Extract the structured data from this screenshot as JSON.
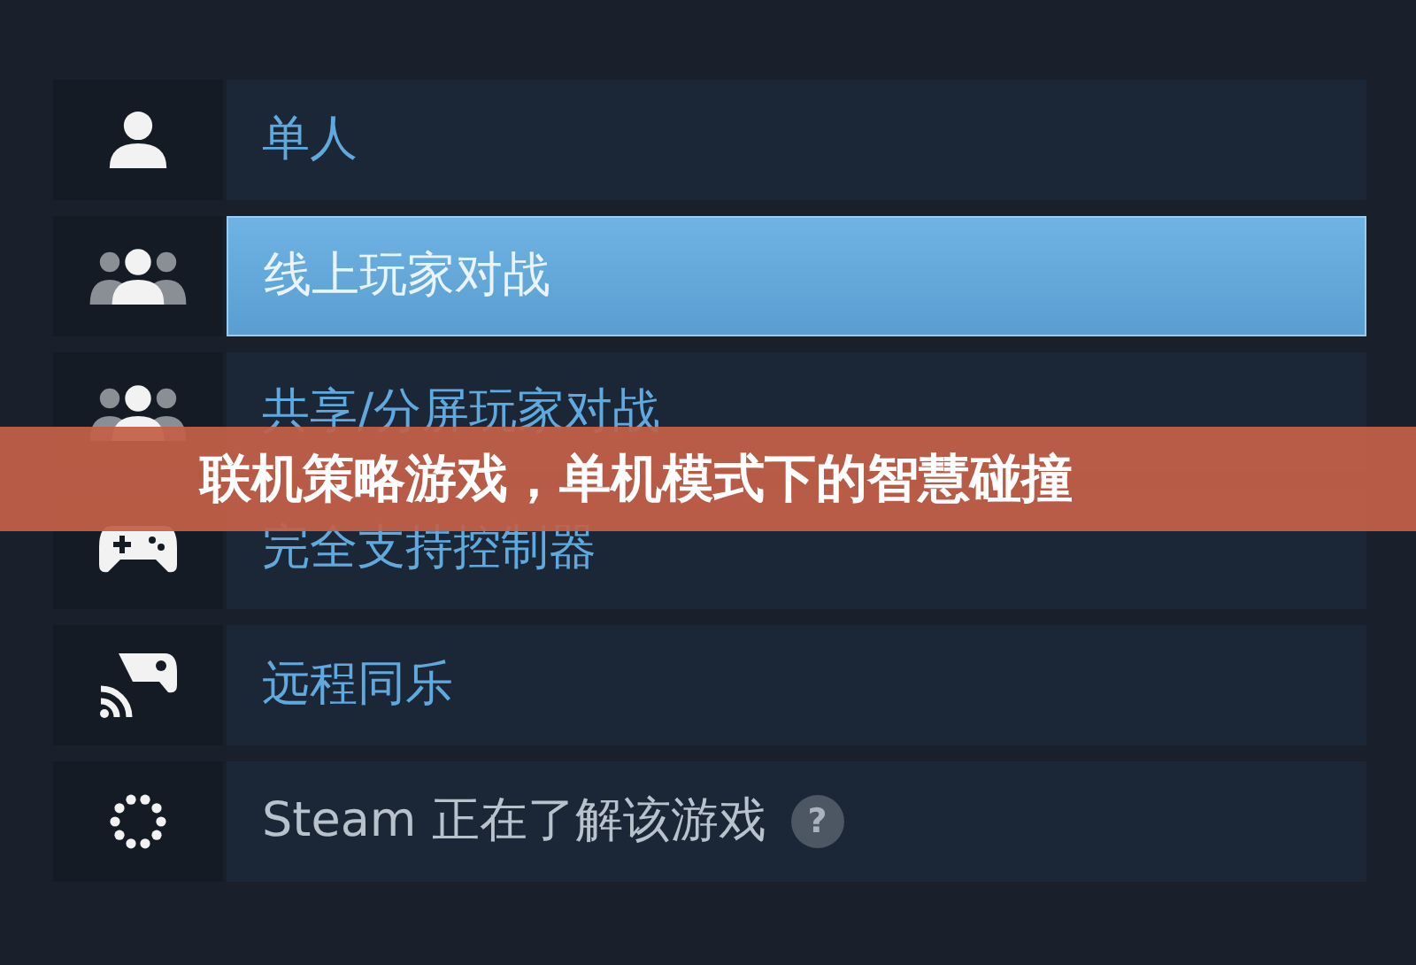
{
  "features": [
    {
      "label": "单人",
      "selected": false,
      "kind": "feature"
    },
    {
      "label": "线上玩家对战",
      "selected": true,
      "kind": "feature"
    },
    {
      "label": "共享/分屏玩家对战",
      "selected": false,
      "kind": "feature"
    },
    {
      "label": "完全支持控制器",
      "selected": false,
      "kind": "feature"
    },
    {
      "label": "远程同乐",
      "selected": false,
      "kind": "feature"
    },
    {
      "label": "Steam 正在了解该游戏",
      "selected": false,
      "kind": "info",
      "help_mark": "?"
    }
  ],
  "banner": {
    "title": "联机策略游戏，单机模式下的智慧碰撞"
  }
}
